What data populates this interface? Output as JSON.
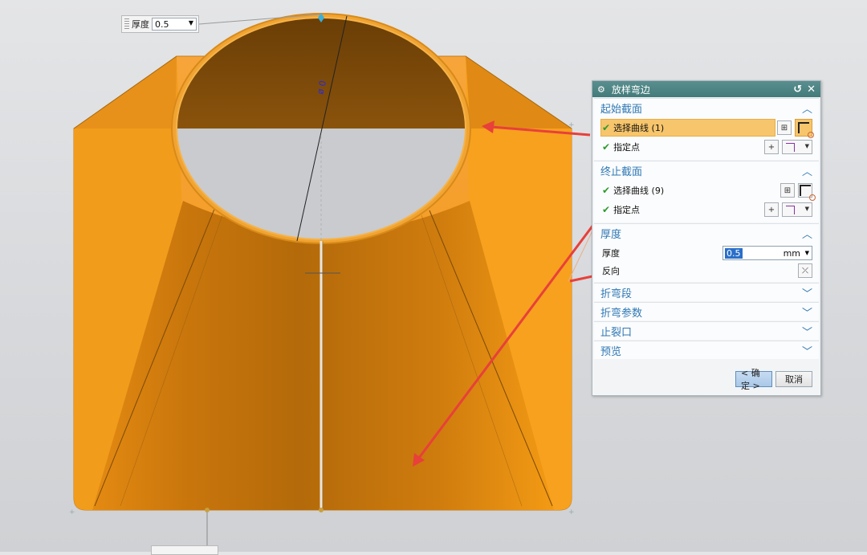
{
  "callout": {
    "label": "厚度",
    "value": "0.5"
  },
  "dialog": {
    "title": "放样弯边",
    "sections": {
      "start": {
        "label": "起始截面",
        "select_curve": "选择曲线 (1)",
        "specify_point": "指定点"
      },
      "end": {
        "label": "终止截面",
        "select_curve": "选择曲线 (9)",
        "specify_point": "指定点"
      },
      "thickness": {
        "label": "厚度",
        "field_label": "厚度",
        "value": "0.5",
        "unit": "mm",
        "reverse_label": "反向"
      },
      "bend_segment": {
        "label": "折弯段"
      },
      "bend_params": {
        "label": "折弯参数"
      },
      "relief": {
        "label": "止裂口"
      },
      "preview": {
        "label": "预览"
      }
    },
    "ok_label": "< 确定 >",
    "cancel_label": "取消"
  },
  "model": {
    "dimension_text": "ø 0",
    "sheet_color": "#f0960f",
    "edge_color": "#e6a23a"
  },
  "annotation_color": "#e8403a"
}
